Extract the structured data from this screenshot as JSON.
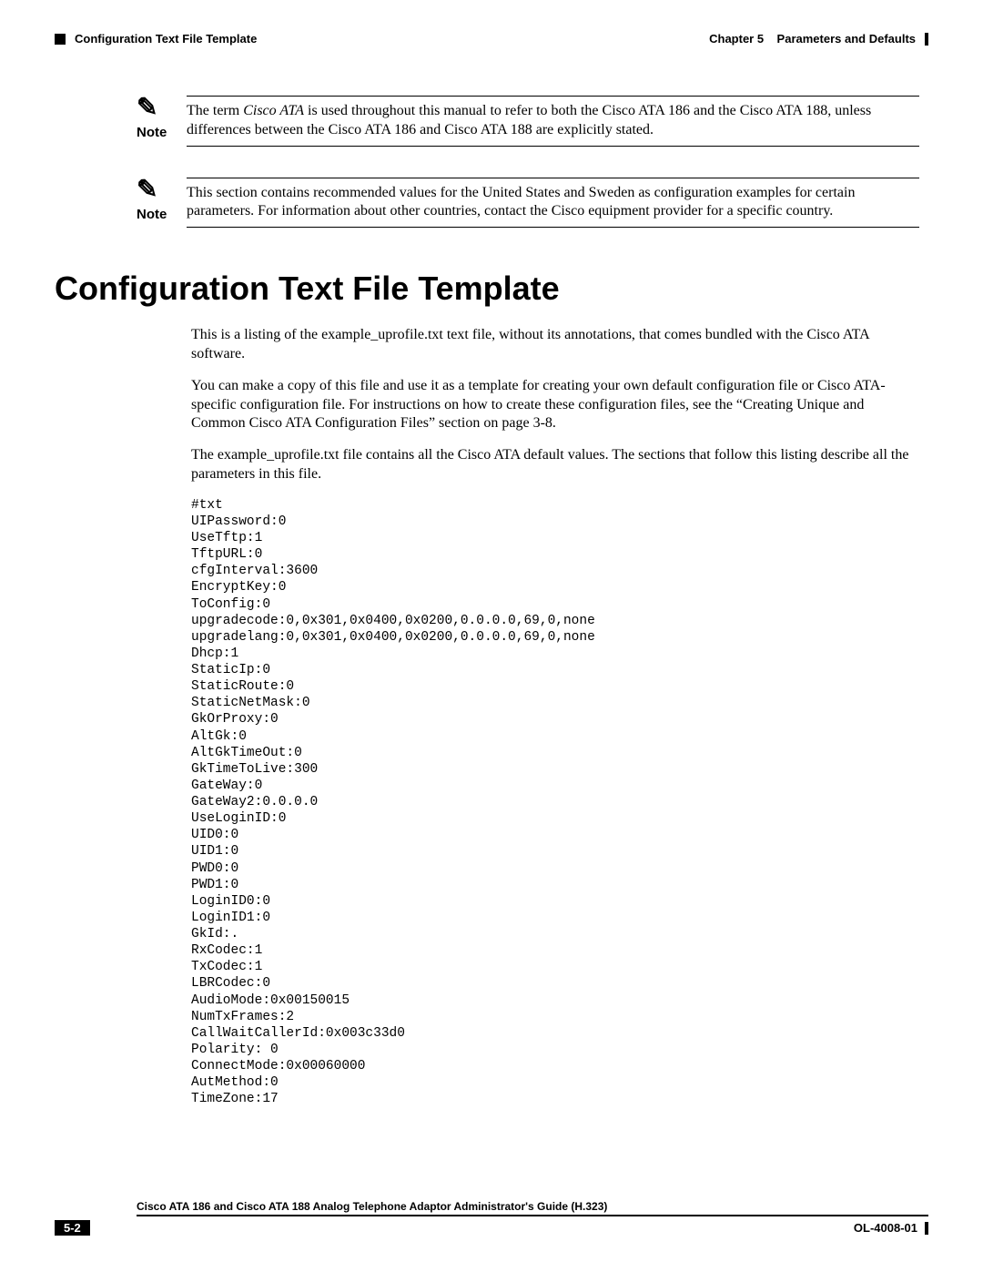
{
  "header": {
    "section_left": "Configuration Text File Template",
    "chapter_label": "Chapter 5",
    "chapter_title": "Parameters and Defaults"
  },
  "note1": {
    "label": "Note",
    "pre_italic": "The term ",
    "italic_term": "Cisco ATA",
    "post_italic": " is used throughout this manual to refer to both the Cisco ATA 186 and the Cisco ATA 188, unless differences between the Cisco ATA 186 and Cisco ATA 188 are explicitly stated."
  },
  "note2": {
    "label": "Note",
    "text": "This section contains recommended values for the United States and Sweden as configuration examples for certain parameters. For information about other countries, contact the Cisco equipment provider for a specific country."
  },
  "section": {
    "title": "Configuration Text File Template",
    "p1": "This is a listing of the example_uprofile.txt text file, without its annotations, that comes bundled with the Cisco ATA software.",
    "p2": "You can make a copy of this file and use it as a template for creating your own default configuration file or Cisco ATA-specific configuration file. For instructions on how to create these configuration files, see the “Creating Unique and Common Cisco ATA Configuration Files” section on page 3-8.",
    "p3": "The example_uprofile.txt file contains all the Cisco ATA default values. The sections that follow this listing describe all the parameters in this file."
  },
  "code": "#txt\nUIPassword:0\nUseTftp:1\nTftpURL:0\ncfgInterval:3600\nEncryptKey:0\nToConfig:0\nupgradecode:0,0x301,0x0400,0x0200,0.0.0.0,69,0,none\nupgradelang:0,0x301,0x0400,0x0200,0.0.0.0,69,0,none\nDhcp:1\nStaticIp:0\nStaticRoute:0\nStaticNetMask:0\nGkOrProxy:0\nAltGk:0\nAltGkTimeOut:0\nGkTimeToLive:300\nGateWay:0\nGateWay2:0.0.0.0\nUseLoginID:0\nUID0:0\nUID1:0\nPWD0:0\nPWD1:0\nLoginID0:0\nLoginID1:0\nGkId:.\nRxCodec:1\nTxCodec:1\nLBRCodec:0\nAudioMode:0x00150015\nNumTxFrames:2\nCallWaitCallerId:0x003c33d0\nPolarity: 0\nConnectMode:0x00060000\nAutMethod:0\nTimeZone:17",
  "footer": {
    "doc_title": "Cisco ATA 186 and Cisco ATA 188 Analog Telephone Adaptor Administrator's Guide (H.323)",
    "page_num": "5-2",
    "doc_code": "OL-4008-01"
  }
}
